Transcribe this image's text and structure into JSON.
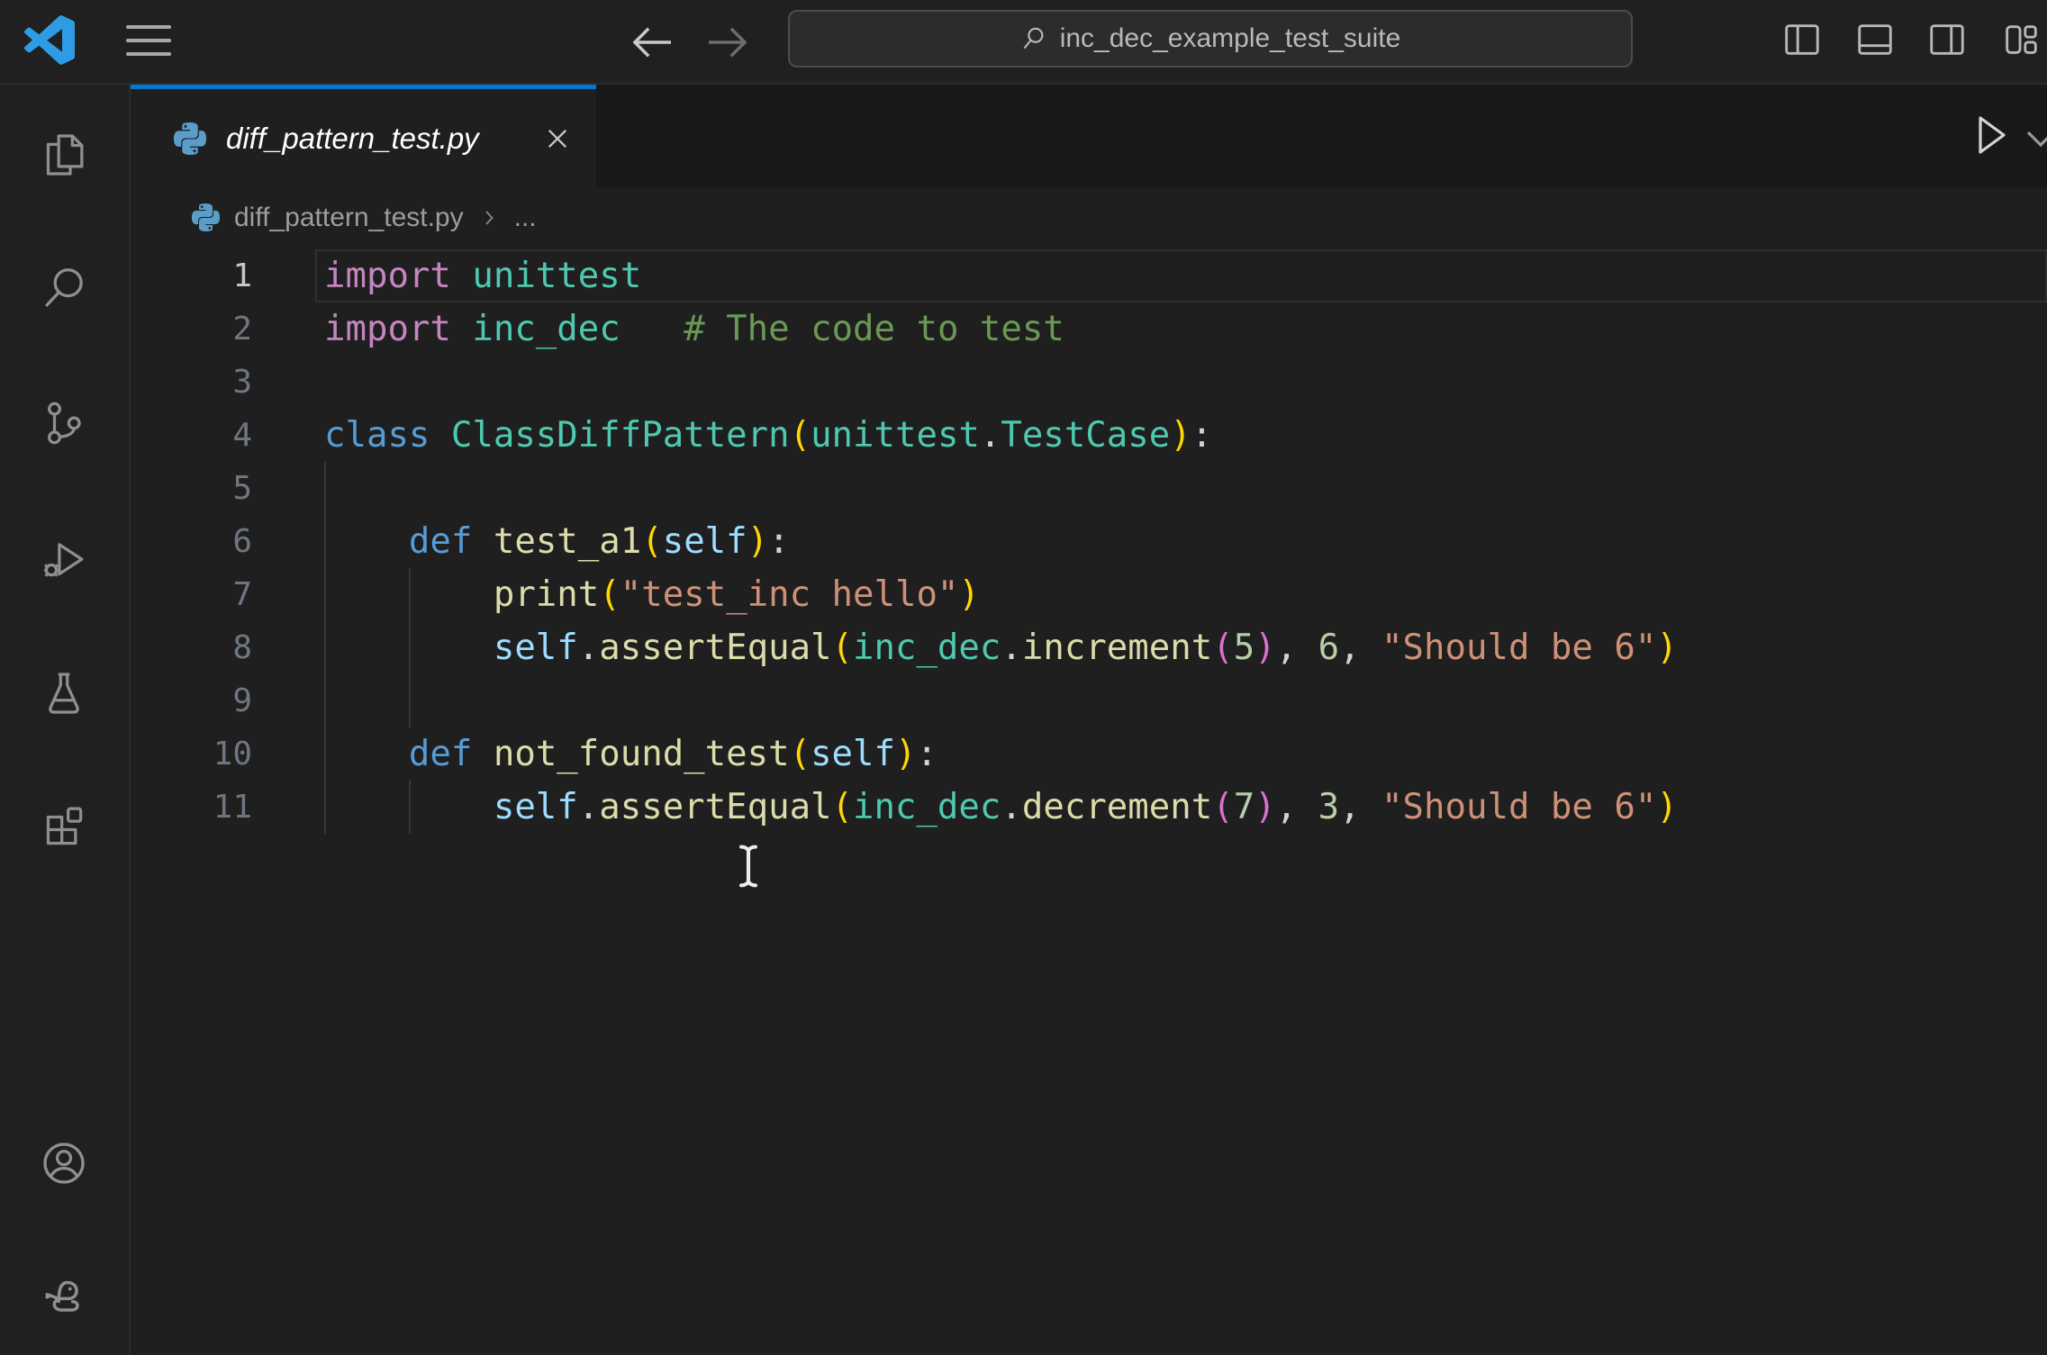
{
  "colors": {
    "accent_tab_border": "#0078D4",
    "editor_background": "#1F1F1F",
    "chrome_background": "#202020",
    "tabstrip_background": "#181818",
    "token_import_keyword": "#C586C0",
    "token_keyword": "#569CD6",
    "token_type": "#4EC9B0",
    "token_function": "#DCDCAA",
    "token_self": "#9CDCFE",
    "token_string": "#CE9178",
    "token_number": "#B5CEA8",
    "token_comment": "#6A9955",
    "token_bracket_level1": "#FFD700",
    "token_bracket_level2": "#DA70D6"
  },
  "title_bar": {
    "logo_icon": "vscode-logo",
    "menu_icon": "hamburger-menu-icon",
    "back_icon": "back-arrow-icon",
    "forward_icon": "forward-arrow-icon",
    "command_center": {
      "icon": "search-icon",
      "query": "inc_dec_example_test_suite"
    },
    "layout_buttons": [
      {
        "name": "toggle-primary-sidebar",
        "icon": "layout-sidebar-left-icon"
      },
      {
        "name": "toggle-panel",
        "icon": "layout-panel-icon"
      },
      {
        "name": "toggle-secondary-sidebar",
        "icon": "layout-sidebar-right-icon"
      },
      {
        "name": "customize-layout",
        "icon": "customize-layout-icon"
      }
    ]
  },
  "activity_bar": {
    "items": [
      {
        "name": "explorer",
        "icon": "files-icon"
      },
      {
        "name": "search",
        "icon": "search-icon"
      },
      {
        "name": "source-control",
        "icon": "git-branch-icon"
      },
      {
        "name": "run-and-debug",
        "icon": "debug-play-bug-icon"
      },
      {
        "name": "testing",
        "icon": "beaker-icon"
      },
      {
        "name": "extensions",
        "icon": "extensions-icon"
      }
    ],
    "bottom_items": [
      {
        "name": "accounts",
        "icon": "account-icon"
      },
      {
        "name": "python-environments",
        "icon": "python-snake-icon"
      }
    ]
  },
  "editor_group": {
    "tab": {
      "label": "diff_pattern_test.py",
      "icon": "python-icon",
      "preview_italic": true,
      "close_icon": "close-icon"
    },
    "run_button_icon": "run-icon",
    "run_dropdown_icon": "chevron-down-icon",
    "breadcrumb": {
      "file_icon": "python-icon",
      "file": "diff_pattern_test.py",
      "separator_icon": "chevron-right-icon",
      "symbol": "..."
    }
  },
  "editor": {
    "lines": [
      {
        "num": 1,
        "active": true,
        "guides": [],
        "tokens": [
          {
            "t": "import",
            "c": "kwi"
          },
          {
            "t": " ",
            "c": "fg"
          },
          {
            "t": "unittest",
            "c": "type"
          }
        ]
      },
      {
        "num": 2,
        "guides": [],
        "tokens": [
          {
            "t": "import",
            "c": "kwi"
          },
          {
            "t": " ",
            "c": "fg"
          },
          {
            "t": "inc_dec",
            "c": "type"
          },
          {
            "t": "   ",
            "c": "fg"
          },
          {
            "t": "# The code to test",
            "c": "com"
          }
        ]
      },
      {
        "num": 3,
        "guides": [],
        "tokens": []
      },
      {
        "num": 4,
        "guides": [],
        "tokens": [
          {
            "t": "class",
            "c": "kw"
          },
          {
            "t": " ",
            "c": "fg"
          },
          {
            "t": "ClassDiffPattern",
            "c": "type"
          },
          {
            "t": "(",
            "c": "b1"
          },
          {
            "t": "unittest",
            "c": "type"
          },
          {
            "t": ".",
            "c": "fg"
          },
          {
            "t": "TestCase",
            "c": "type"
          },
          {
            "t": ")",
            "c": "b1"
          },
          {
            "t": ":",
            "c": "fg"
          }
        ]
      },
      {
        "num": 5,
        "guides": [
          0
        ],
        "tokens": []
      },
      {
        "num": 6,
        "guides": [
          0
        ],
        "tokens": [
          {
            "t": "    ",
            "c": "fg"
          },
          {
            "t": "def",
            "c": "kw"
          },
          {
            "t": " ",
            "c": "fg"
          },
          {
            "t": "test_a1",
            "c": "fn"
          },
          {
            "t": "(",
            "c": "b1"
          },
          {
            "t": "self",
            "c": "self"
          },
          {
            "t": ")",
            "c": "b1"
          },
          {
            "t": ":",
            "c": "fg"
          }
        ]
      },
      {
        "num": 7,
        "guides": [
          0,
          4
        ],
        "tokens": [
          {
            "t": "        ",
            "c": "fg"
          },
          {
            "t": "print",
            "c": "fn"
          },
          {
            "t": "(",
            "c": "b1"
          },
          {
            "t": "\"test_inc hello\"",
            "c": "str"
          },
          {
            "t": ")",
            "c": "b1"
          }
        ]
      },
      {
        "num": 8,
        "guides": [
          0,
          4
        ],
        "tokens": [
          {
            "t": "        ",
            "c": "fg"
          },
          {
            "t": "self",
            "c": "self"
          },
          {
            "t": ".",
            "c": "fg"
          },
          {
            "t": "assertEqual",
            "c": "fn"
          },
          {
            "t": "(",
            "c": "b1"
          },
          {
            "t": "inc_dec",
            "c": "type"
          },
          {
            "t": ".",
            "c": "fg"
          },
          {
            "t": "increment",
            "c": "fn"
          },
          {
            "t": "(",
            "c": "b2"
          },
          {
            "t": "5",
            "c": "num"
          },
          {
            "t": ")",
            "c": "b2"
          },
          {
            "t": ",",
            "c": "fg"
          },
          {
            "t": " ",
            "c": "fg"
          },
          {
            "t": "6",
            "c": "num"
          },
          {
            "t": ",",
            "c": "fg"
          },
          {
            "t": " ",
            "c": "fg"
          },
          {
            "t": "\"Should be 6\"",
            "c": "str"
          },
          {
            "t": ")",
            "c": "b1"
          }
        ]
      },
      {
        "num": 9,
        "guides": [
          0,
          4
        ],
        "tokens": []
      },
      {
        "num": 10,
        "guides": [
          0
        ],
        "tokens": [
          {
            "t": "    ",
            "c": "fg"
          },
          {
            "t": "def",
            "c": "kw"
          },
          {
            "t": " ",
            "c": "fg"
          },
          {
            "t": "not_found_test",
            "c": "fn"
          },
          {
            "t": "(",
            "c": "b1"
          },
          {
            "t": "self",
            "c": "self"
          },
          {
            "t": ")",
            "c": "b1"
          },
          {
            "t": ":",
            "c": "fg"
          }
        ]
      },
      {
        "num": 11,
        "guides": [
          0,
          4
        ],
        "tokens": [
          {
            "t": "        ",
            "c": "fg"
          },
          {
            "t": "self",
            "c": "self"
          },
          {
            "t": ".",
            "c": "fg"
          },
          {
            "t": "assertEqual",
            "c": "fn"
          },
          {
            "t": "(",
            "c": "b1"
          },
          {
            "t": "inc_dec",
            "c": "type"
          },
          {
            "t": ".",
            "c": "fg"
          },
          {
            "t": "decrement",
            "c": "fn"
          },
          {
            "t": "(",
            "c": "b2"
          },
          {
            "t": "7",
            "c": "num"
          },
          {
            "t": ")",
            "c": "b2"
          },
          {
            "t": ",",
            "c": "fg"
          },
          {
            "t": " ",
            "c": "fg"
          },
          {
            "t": "3",
            "c": "num"
          },
          {
            "t": ",",
            "c": "fg"
          },
          {
            "t": " ",
            "c": "fg"
          },
          {
            "t": "\"Should be 6\"",
            "c": "str"
          },
          {
            "t": ")",
            "c": "b1"
          }
        ]
      }
    ]
  },
  "pointer": {
    "type": "ibeam-mouse-cursor"
  }
}
